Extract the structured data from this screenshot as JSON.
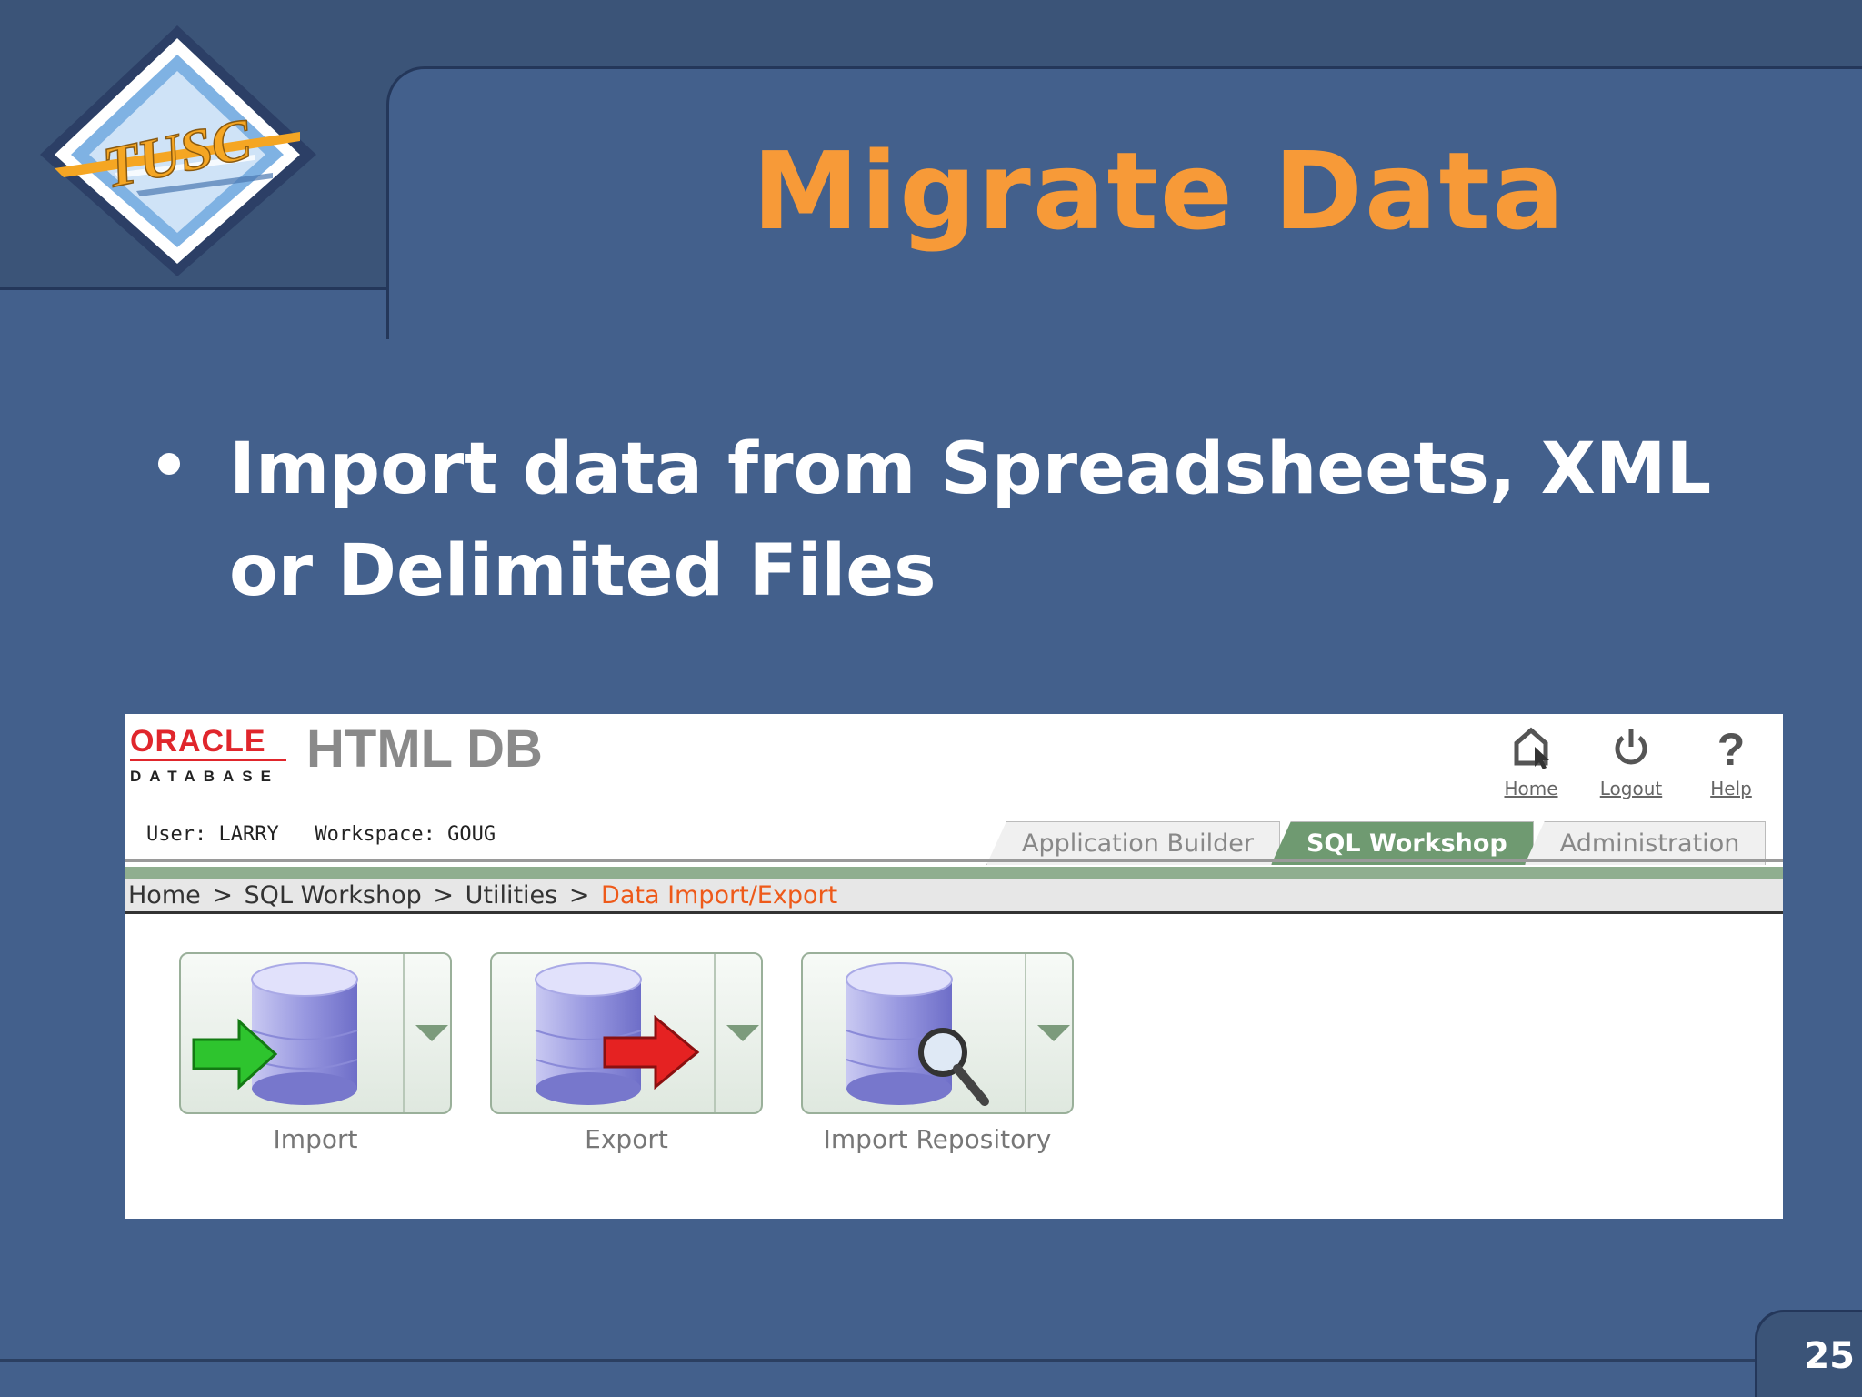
{
  "slide": {
    "title": "Migrate Data",
    "bullet": "Import data from Spreadsheets, XML or Delimited Files",
    "page_number": "25",
    "logo_text": "TUSC",
    "colors": {
      "background": "#43608c",
      "title": "#f79a38",
      "bullet": "#ffffff"
    }
  },
  "screenshot": {
    "brand": {
      "oracle": "ORACLE",
      "database": "DATABASE",
      "product": "HTML DB"
    },
    "nav": {
      "home": "Home",
      "logout": "Logout",
      "help": "Help"
    },
    "user_info": "User: LARRY   Workspace: GOUG",
    "tabs": [
      "Application Builder",
      "SQL Workshop",
      "Administration"
    ],
    "active_tab": "SQL Workshop",
    "breadcrumb": {
      "items": [
        "Home",
        "SQL Workshop",
        "Utilities"
      ],
      "separator": ">",
      "current": "Data Import/Export"
    },
    "tiles": [
      {
        "label": "Import",
        "icon": "database-import-icon"
      },
      {
        "label": "Export",
        "icon": "database-export-icon"
      },
      {
        "label": "Import Repository",
        "icon": "database-search-icon"
      }
    ]
  }
}
